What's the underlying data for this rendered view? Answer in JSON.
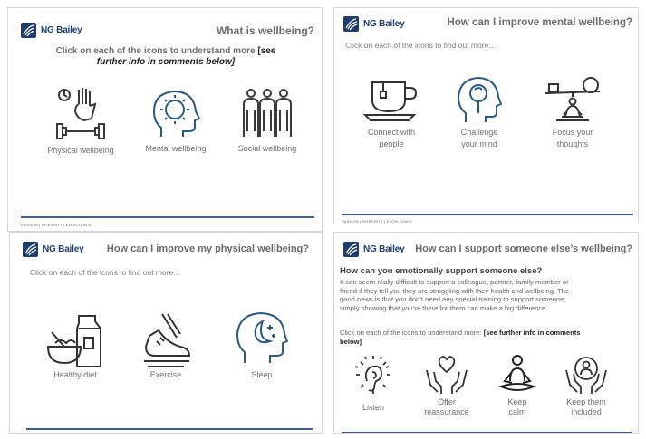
{
  "brand": {
    "name": "NG Bailey",
    "tagline": "PASSION | INTEGRITY | EXCELLENCE",
    "accent": "#1e3e6b",
    "rule": "#3f5f8f"
  },
  "slide1": {
    "title": "What is wellbeing?",
    "intro_plain": "Click on each of the icons to understand more ",
    "intro_bold_1": "[see",
    "intro_bold_2": "further info in comments below]",
    "items": [
      {
        "label": "Physical wellbeing",
        "icon": "dumbbell-hand-icon"
      },
      {
        "label": "Mental wellbeing",
        "icon": "head-sun-icon"
      },
      {
        "label": "Social wellbeing",
        "icon": "people-group-icon"
      }
    ]
  },
  "slide2": {
    "title": "How can I improve mental wellbeing?",
    "intro": "Click on each of the icons to find out more…",
    "items": [
      {
        "label_1": "Connect with",
        "label_2": "people",
        "icon": "tea-cup-icon"
      },
      {
        "label_1": "Challenge",
        "label_2": "your mind",
        "icon": "head-magnifier-icon"
      },
      {
        "label_1": "Focus your",
        "label_2": "thoughts",
        "icon": "meditation-balance-icon"
      }
    ]
  },
  "slide3": {
    "title": "How can I improve my physical wellbeing?",
    "intro": "Click on each of the icons to find out more…",
    "items": [
      {
        "label": "Healthy diet",
        "icon": "milk-bowl-icon"
      },
      {
        "label": "Exercise",
        "icon": "running-shoe-icon"
      },
      {
        "label": "Sleep",
        "icon": "head-moon-icon"
      }
    ]
  },
  "slide4": {
    "title": "How can I support someone else’s wellbeing?",
    "heading": "How can you emotionally support someone else?",
    "para_1": "It can seem really difficult to support a colleague, partner, family member or",
    "para_2": "friend if they tell you they are struggling with their health and wellbeing. The",
    "para_3": "good news is that you don’t need any special training to support someone;",
    "para_4": "simply showing that you’re there for them can make a big difference.",
    "click_plain": "Click on each of the icons to understand more: ",
    "click_bold_1": "[see further info in comments",
    "click_bold_2": "below]",
    "items": [
      {
        "label_1": "Listen",
        "label_2": "",
        "icon": "ear-icon"
      },
      {
        "label_1": "Offer",
        "label_2": "reassurance",
        "icon": "hands-heart-icon"
      },
      {
        "label_1": "Keep",
        "label_2": "calm",
        "icon": "meditating-person-icon"
      },
      {
        "label_1": "Keep them",
        "label_2": "included",
        "icon": "hands-person-icon"
      }
    ]
  }
}
